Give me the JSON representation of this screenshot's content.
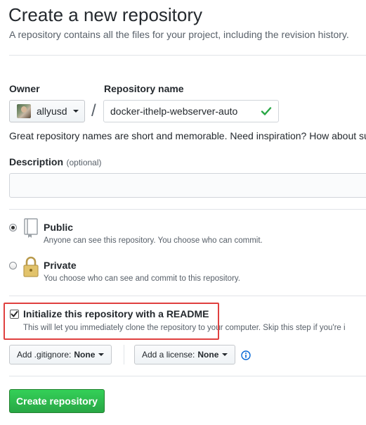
{
  "header": {
    "title": "Create a new repository",
    "subtitle": "A repository contains all the files for your project, including the revision history."
  },
  "owner": {
    "label": "Owner",
    "value": "allyusd"
  },
  "repo_name": {
    "label": "Repository name",
    "value": "docker-ithelp-webserver-auto"
  },
  "hint": "Great repository names are short and memorable. Need inspiration? How about su",
  "description": {
    "label": "Description",
    "optional": "(optional)",
    "value": ""
  },
  "visibility": {
    "selected": "public",
    "public": {
      "title": "Public",
      "desc": "Anyone can see this repository. You choose who can commit."
    },
    "private": {
      "title": "Private",
      "desc": "You choose who can see and commit to this repository."
    }
  },
  "readme": {
    "checked": true,
    "title": "Initialize this repository with a README",
    "desc": "This will let you immediately clone the repository to your computer. Skip this step if you're i"
  },
  "gitignore": {
    "label": "Add .gitignore:",
    "value": "None"
  },
  "license": {
    "label": "Add a license:",
    "value": "None"
  },
  "create_button": "Create repository",
  "colors": {
    "accent_green": "#28a745",
    "highlight_red": "#e0403f",
    "info_blue": "#0366d6"
  }
}
